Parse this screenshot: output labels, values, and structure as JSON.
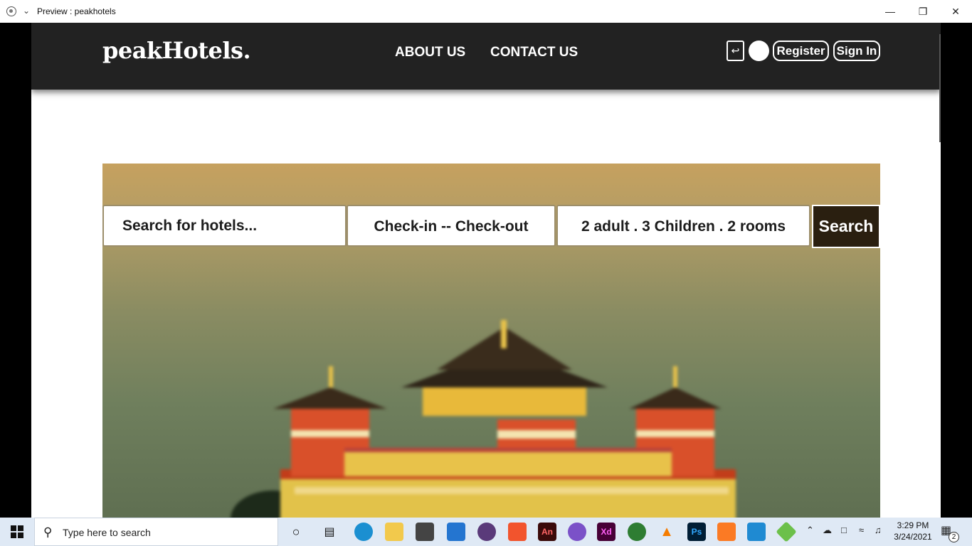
{
  "window": {
    "title": "Preview : peakhotels"
  },
  "header": {
    "logo": "peakHotels.",
    "nav": [
      "ABOUT US",
      "CONTACT US"
    ],
    "register_label": "Register",
    "signin_label": "Sign In"
  },
  "search": {
    "hotel_placeholder": "Search for hotels...",
    "dates_label": "Check-in  --  Check-out",
    "guests_label": "2 adult . 3 Children . 2 rooms",
    "button_label": "Search"
  },
  "taskbar": {
    "search_placeholder": "Type here to search",
    "time": "3:29 PM",
    "date": "3/24/2021",
    "notification_count": "2",
    "pinned_icons": [
      "cortana-icon",
      "task-view-icon",
      "edge-icon",
      "file-explorer-icon",
      "store-icon",
      "mail-icon",
      "affinity-icon",
      "brave-icon",
      "animate-icon",
      "viber-icon",
      "xd-icon",
      "globe-icon",
      "vlc-icon",
      "photoshop-icon",
      "xampp-icon",
      "vscode-icon",
      "git-icon"
    ]
  },
  "colors": {
    "navbar": "#222222",
    "search_button": "#2a1f10",
    "field_border": "#9c8e6a"
  }
}
